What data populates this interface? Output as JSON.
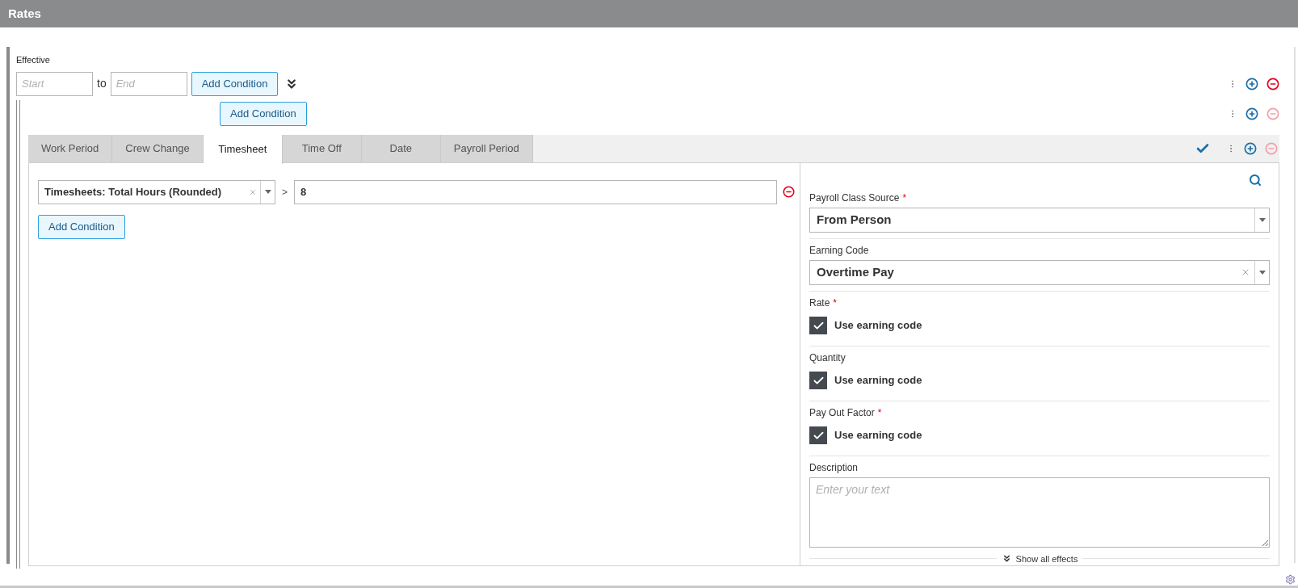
{
  "header": {
    "title": "Rates"
  },
  "effective": {
    "label": "Effective",
    "start": {
      "placeholder": "Start"
    },
    "separator": "to",
    "end": {
      "placeholder": "End"
    },
    "add_button": "Add Condition",
    "remove_disabled": false
  },
  "group": {
    "add_button": "Add Condition",
    "remove_disabled": true
  },
  "tabs": [
    {
      "label": "Work Period",
      "selected": false
    },
    {
      "label": "Crew Change",
      "selected": false
    },
    {
      "label": "Timesheet",
      "selected": true
    },
    {
      "label": "Time Off",
      "selected": false
    },
    {
      "label": "Date",
      "selected": false
    },
    {
      "label": "Payroll Period",
      "selected": false
    }
  ],
  "tabs_bar": {
    "remove_disabled": true
  },
  "conditions": [
    {
      "field": "Timesheets: Total Hours (Rounded)",
      "operator": ">",
      "value": "8"
    }
  ],
  "add_condition": "Add Condition",
  "effects": [
    {
      "kind": "select",
      "label": "Payroll Class Source",
      "required_mark": "*",
      "value": "From Person",
      "clearable": false
    },
    {
      "kind": "select",
      "label": "Earning Code",
      "value": "Overtime Pay",
      "clearable": true
    },
    {
      "kind": "checkbox",
      "label": "Rate",
      "required_mark": "*",
      "option": "Use earning code",
      "checked": true
    },
    {
      "kind": "checkbox",
      "label": "Quantity",
      "option": "Use earning code",
      "checked": true
    },
    {
      "kind": "checkbox",
      "label": "Pay Out Factor",
      "required_mark": "*",
      "option": "Use earning code",
      "checked": true
    },
    {
      "kind": "textarea",
      "label": "Description",
      "placeholder": "Enter your text"
    }
  ],
  "show_all": "Show all effects"
}
